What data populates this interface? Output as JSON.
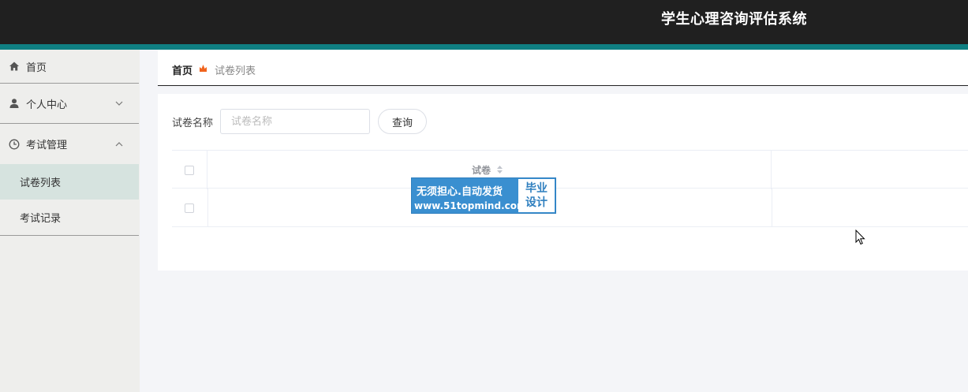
{
  "header": {
    "title": "学生心理咨询评估系统"
  },
  "sidebar": {
    "items": [
      {
        "label": "首页",
        "icon": "home-icon"
      },
      {
        "label": "个人中心",
        "icon": "user-icon",
        "expanded": false
      },
      {
        "label": "考试管理",
        "icon": "clock-icon",
        "expanded": true
      }
    ],
    "exam_sub": [
      {
        "label": "试卷列表",
        "active": true
      },
      {
        "label": "考试记录",
        "active": false
      }
    ]
  },
  "breadcrumb": {
    "home": "首页",
    "current": "试卷列表",
    "separator_icon": "flame-icon"
  },
  "search": {
    "label": "试卷名称",
    "placeholder": "试卷名称",
    "value": "",
    "button": "查询"
  },
  "table": {
    "columns": [
      "试卷"
    ],
    "rows": [
      {
        "paper": ""
      }
    ]
  },
  "watermark": {
    "line1": "无须担心.自动发货",
    "line2": "www.51topmind.com",
    "box_line1": "毕业",
    "box_line2": "设计"
  },
  "colors": {
    "topbar": "#202020",
    "accent": "#0f7f82",
    "active_menu": "#d6e3df",
    "breadcrumb_icon": "#f0641e",
    "watermark": "#3a8fd0"
  }
}
